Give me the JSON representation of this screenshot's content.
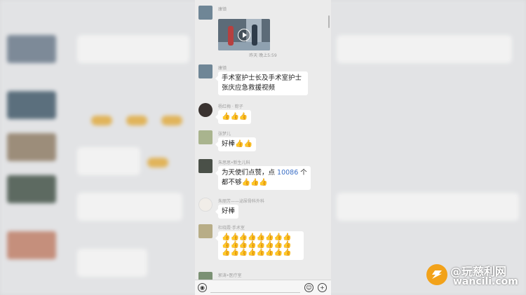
{
  "chat": {
    "time_divider": "昨天 晚上5:59",
    "messages": [
      {
        "name": "康镇",
        "type": "video"
      },
      {
        "name": "康镇",
        "text": "手术室护士长及手术室护士张庆应急救援视频"
      },
      {
        "name": "杨红梅 · 粽子",
        "emojis": "👍👍👍"
      },
      {
        "name": "张梦儿",
        "text": "好棒",
        "emojis": "👍👍"
      },
      {
        "name": "朱思思•新生儿科",
        "text_before": "为天使们点赞，点 ",
        "number": "10086",
        "text_after": " 个都不够",
        "emojis": "👍👍👍"
      },
      {
        "name": "朱丽芳——泌尿骨科外科",
        "text": "好棒"
      },
      {
        "name": "杜晓霞·手术室",
        "emojis": "👍👍👍👍👍👍👍👍👍👍👍👍👍👍👍👍👍👍👍👍👍👍👍👍"
      },
      {
        "name": "郭涛•医疗室"
      }
    ]
  },
  "input_bar": {
    "voice_icon": "voice-icon",
    "emoji_icon": "emoji-icon",
    "plus_icon": "plus-icon"
  },
  "watermark": {
    "brand": "@玩慈利网",
    "domain": "wancili.com"
  },
  "colors": {
    "chat_bg": "#ebebeb",
    "bubble": "#ffffff",
    "number_link": "#3b6fc6",
    "watermark_logo": "#f2a21a"
  }
}
